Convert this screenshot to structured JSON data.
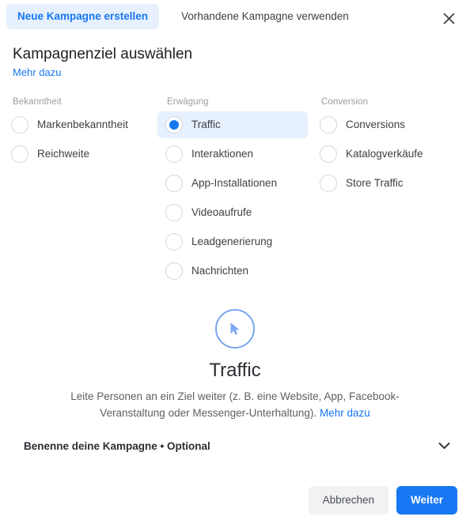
{
  "tabs": [
    {
      "label": "Neue Kampagne erstellen",
      "active": true
    },
    {
      "label": "Vorhandene Kampagne verwenden",
      "active": false
    }
  ],
  "close_icon": "close-icon",
  "header": {
    "title": "Kampagnenziel auswählen",
    "learn_more": "Mehr dazu"
  },
  "columns": [
    {
      "title": "Bekanntheit",
      "options": [
        {
          "label": "Markenbekanntheit",
          "selected": false
        },
        {
          "label": "Reichweite",
          "selected": false
        }
      ]
    },
    {
      "title": "Erwägung",
      "options": [
        {
          "label": "Traffic",
          "selected": true
        },
        {
          "label": "Interaktionen",
          "selected": false
        },
        {
          "label": "App-Installationen",
          "selected": false
        },
        {
          "label": "Videoaufrufe",
          "selected": false
        },
        {
          "label": "Leadgenerierung",
          "selected": false
        },
        {
          "label": "Nachrichten",
          "selected": false
        }
      ]
    },
    {
      "title": "Conversion",
      "options": [
        {
          "label": "Conversions",
          "selected": false
        },
        {
          "label": "Katalogverkäufe",
          "selected": false
        },
        {
          "label": "Store Traffic",
          "selected": false
        }
      ]
    }
  ],
  "preview": {
    "icon": "cursor-pointer-icon",
    "title": "Traffic",
    "description": "Leite Personen an ein Ziel weiter (z. B. eine Website, App, Facebook-Veranstaltung oder Messenger-Unterhaltung).",
    "learn_more": "Mehr dazu"
  },
  "campaign_name_section": {
    "label": "Benenne deine Kampagne • Optional",
    "chevron_icon": "chevron-down-icon"
  },
  "footer": {
    "cancel_label": "Abbrechen",
    "next_label": "Weiter"
  },
  "colors": {
    "accent": "#1877f2",
    "accent_soft": "#e7f0fd",
    "icon_blue": "#7aa5f0",
    "muted_text": "#9a9da1",
    "body_text": "#3d4044"
  }
}
